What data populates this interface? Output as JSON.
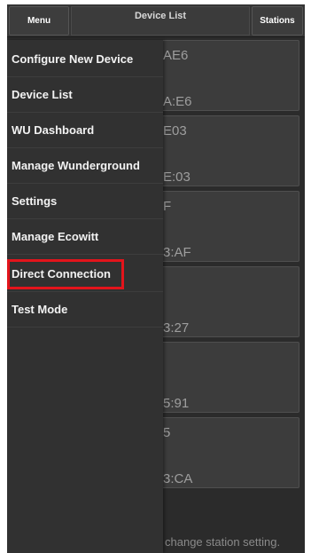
{
  "topbar": {
    "menu_label": "Menu",
    "title": "Device List",
    "stations_label": "Stations"
  },
  "drawer": {
    "items": [
      {
        "label": "Configure New Device"
      },
      {
        "label": "Device List"
      },
      {
        "label": "WU Dashboard"
      },
      {
        "label": "Manage Wunderground"
      },
      {
        "label": "Settings"
      },
      {
        "label": "Manage Ecowitt"
      },
      {
        "label": "Direct Connection",
        "highlighted": true
      },
      {
        "label": "Test Mode"
      }
    ]
  },
  "devices": [
    {
      "line1": "AE6",
      "line2": "A:E6"
    },
    {
      "line1": "E03",
      "line2": "E:03"
    },
    {
      "line1": "F",
      "line2": "3:AF"
    },
    {
      "line1": "",
      "line2": "3:27"
    },
    {
      "line1": "",
      "line2": "5:91"
    },
    {
      "line1": "5",
      "line2": "3:CA"
    }
  ],
  "footer": {
    "hint": "change station setting."
  },
  "colors": {
    "highlight": "#e3141b",
    "drawer_bg": "#313131",
    "topbar_bg": "#353535"
  }
}
